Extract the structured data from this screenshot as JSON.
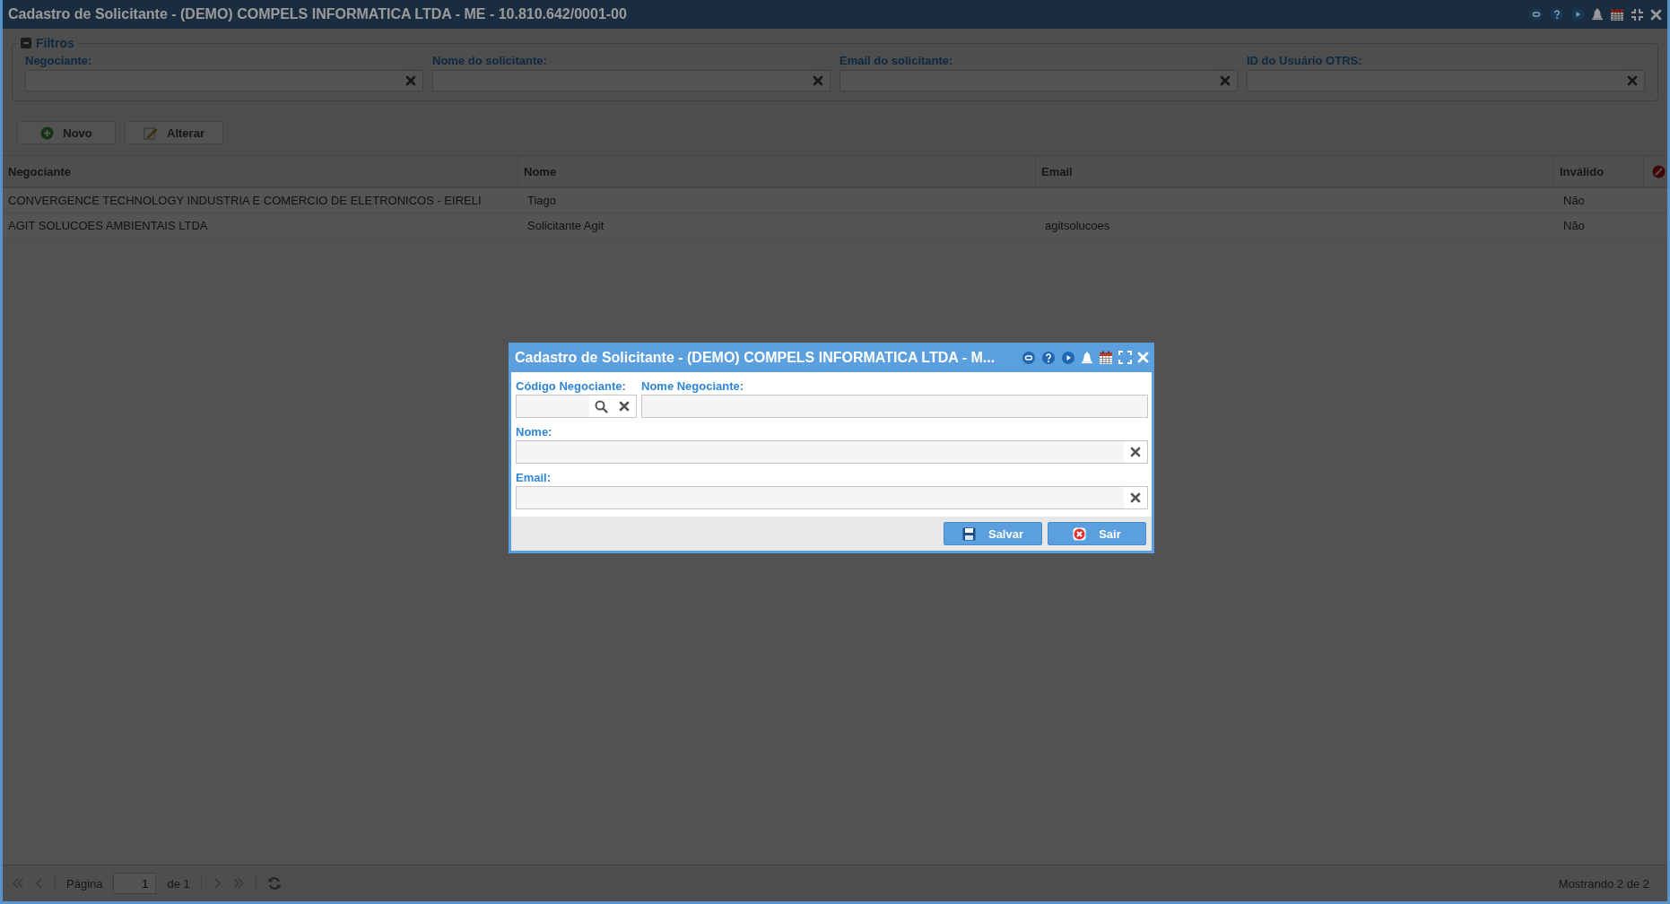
{
  "window": {
    "title": "Cadastro de Solicitante - (DEMO) COMPELS INFORMATICA LTDA - ME - 10.810.642/0001-00"
  },
  "filters": {
    "legend": "Filtros",
    "expanded": true,
    "fields": [
      {
        "label": "Negociante:"
      },
      {
        "label": "Nome do solicitante:"
      },
      {
        "label": "Email do solicitante:"
      },
      {
        "label": "ID do Usuário OTRS:"
      }
    ]
  },
  "toolbar": [
    {
      "label": "Novo",
      "kind": "add"
    },
    {
      "label": "Alterar",
      "kind": "edit"
    }
  ],
  "table": {
    "columns": [
      "Negociante",
      "Nome",
      "Email",
      "Inválido"
    ],
    "rows": [
      {
        "negociante": "CONVERGENCE TECHNOLOGY INDUSTRIA E COMERCIO DE ELETRONICOS - EIRELI",
        "nome": "Tiago",
        "invalido": "Não"
      },
      {
        "negociante": "AGIT SOLUCOES AMBIENTAIS LTDA",
        "nome": "Solicitante Agit",
        "email": "agitsolucoes",
        "invalido": "Não"
      }
    ]
  },
  "pager": {
    "page_label": "Página",
    "page": "1",
    "page_count": "de 1",
    "summary": "Mostrando 2 de 2"
  },
  "dialog": {
    "title": "Cadastro de Solicitante - (DEMO) COMPELS INFORMATICA LTDA - M...",
    "fields": [
      {
        "label": "Código Negociante:",
        "kind": "lookup"
      },
      {
        "label": "Nome Negociante:",
        "kind": "plain"
      },
      {
        "label": "Nome:",
        "kind": "clearable"
      },
      {
        "label": "Email:",
        "kind": "clearable"
      }
    ],
    "buttons": [
      {
        "label": "Salvar",
        "kind": "save"
      },
      {
        "label": "Sair",
        "kind": "exit"
      }
    ]
  }
}
